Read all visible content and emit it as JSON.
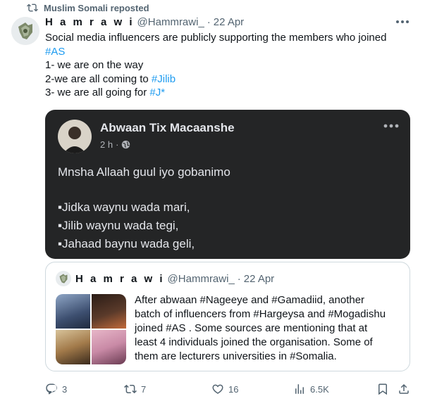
{
  "repost": {
    "label": "Muslim Somali reposted"
  },
  "tweet": {
    "author_name": "H a m r a w i",
    "handle": "@Hammrawi_",
    "separator": "·",
    "time": "22 Apr",
    "lines": [
      "Social media influencers are publicly supporting the members who joined",
      "#AS",
      "1- we are on the way",
      "2-we are all coming to ",
      "#Jilib",
      "3- we are all going for ",
      "#J*"
    ]
  },
  "facebook_card": {
    "name": "Abwaan Tix Macaanshe",
    "time": "2 h",
    "separator": "·",
    "line1": "Mnsha Allaah guul iyo gobanimo",
    "list": [
      "▪Jidka waynu wada mari,",
      "▪Jilib waynu wada tegi,",
      "▪Jahaad baynu wada geli,"
    ]
  },
  "quote": {
    "author_name": "H a m r a w i",
    "handle": "@Hammrawi_",
    "separator": "·",
    "time": "22 Apr",
    "lines": [
      "After abwaan #Nageeye and #Gamadiid, another",
      "batch of influencers from #Hargeysa and #Mogadishu",
      "joined #AS . Some sources are mentioning that  at",
      "least 4 individuals joined the organisation. Some of",
      "them are lecturers universities in #Somalia."
    ]
  },
  "actions": {
    "replies": "3",
    "reposts": "7",
    "likes": "16",
    "views": "6.5K"
  },
  "colors": {
    "accent": "#1d9bf0",
    "secondary_text": "#536471",
    "card_dark": "#242526"
  }
}
